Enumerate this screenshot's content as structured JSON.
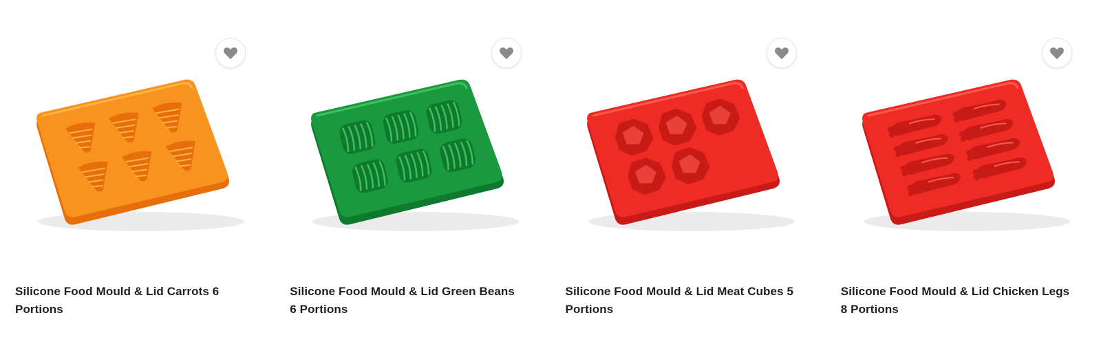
{
  "products": [
    {
      "title": "Silicone Food Mould & Lid Carrots 6 Portions",
      "color": "#f7931e",
      "dark": "#e66f0c",
      "light": "#ffb347",
      "shape": "carrots",
      "wishlist_icon": "heart-icon"
    },
    {
      "title": "Silicone Food Mould & Lid Green Beans 6 Portions",
      "color": "#1a9a3f",
      "dark": "#0f7a2d",
      "light": "#3fbf5f",
      "shape": "green-beans",
      "wishlist_icon": "heart-icon"
    },
    {
      "title": "Silicone Food Mould & Lid Meat Cubes 5 Portions",
      "color": "#ee2b24",
      "dark": "#c81a16",
      "light": "#ff5a4e",
      "shape": "meat-cubes",
      "wishlist_icon": "heart-icon"
    },
    {
      "title": "Silicone Food Mould & Lid Chicken Legs 8 Portions",
      "color": "#ee2b24",
      "dark": "#c81a16",
      "light": "#ff5a4e",
      "shape": "chicken-legs",
      "wishlist_icon": "heart-icon"
    }
  ]
}
